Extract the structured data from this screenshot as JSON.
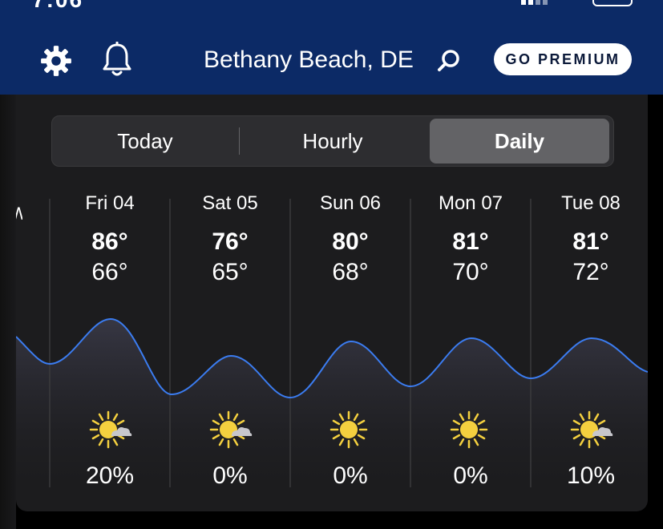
{
  "header": {
    "location": "Bethany Beach, DE",
    "premium_label": "GO PREMIUM",
    "bg_color": "#0c2a66"
  },
  "tabs": [
    {
      "label": "Today",
      "selected": false
    },
    {
      "label": "Hourly",
      "selected": false
    },
    {
      "label": "Daily",
      "selected": true
    }
  ],
  "days": [
    {
      "label": "Fri 04",
      "high": "86°",
      "low": "66°",
      "icon": "sun-cloud-icon",
      "precip": "20%"
    },
    {
      "label": "Sat 05",
      "high": "76°",
      "low": "65°",
      "icon": "sun-cloud-icon",
      "precip": "0%"
    },
    {
      "label": "Sun 06",
      "high": "80°",
      "low": "68°",
      "icon": "sun-icon",
      "precip": "0%"
    },
    {
      "label": "Mon 07",
      "high": "81°",
      "low": "70°",
      "icon": "sun-icon",
      "precip": "0%"
    },
    {
      "label": "Tue 08",
      "high": "81°",
      "low": "72°",
      "icon": "sun-cloud-icon",
      "precip": "10%"
    }
  ],
  "colors": {
    "curve": "#3b7cf0",
    "sun": "#f4d03f",
    "cloud": "#c7c7cc"
  }
}
